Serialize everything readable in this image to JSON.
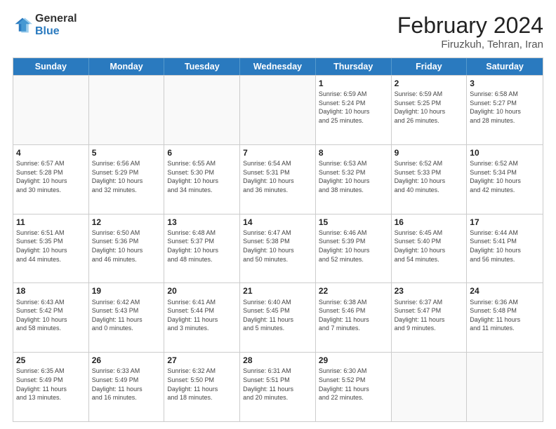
{
  "logo": {
    "general": "General",
    "blue": "Blue"
  },
  "title": "February 2024",
  "subtitle": "Firuzkuh, Tehran, Iran",
  "days": [
    "Sunday",
    "Monday",
    "Tuesday",
    "Wednesday",
    "Thursday",
    "Friday",
    "Saturday"
  ],
  "weeks": [
    [
      {
        "day": "",
        "info": ""
      },
      {
        "day": "",
        "info": ""
      },
      {
        "day": "",
        "info": ""
      },
      {
        "day": "",
        "info": ""
      },
      {
        "day": "1",
        "info": "Sunrise: 6:59 AM\nSunset: 5:24 PM\nDaylight: 10 hours\nand 25 minutes."
      },
      {
        "day": "2",
        "info": "Sunrise: 6:59 AM\nSunset: 5:25 PM\nDaylight: 10 hours\nand 26 minutes."
      },
      {
        "day": "3",
        "info": "Sunrise: 6:58 AM\nSunset: 5:27 PM\nDaylight: 10 hours\nand 28 minutes."
      }
    ],
    [
      {
        "day": "4",
        "info": "Sunrise: 6:57 AM\nSunset: 5:28 PM\nDaylight: 10 hours\nand 30 minutes."
      },
      {
        "day": "5",
        "info": "Sunrise: 6:56 AM\nSunset: 5:29 PM\nDaylight: 10 hours\nand 32 minutes."
      },
      {
        "day": "6",
        "info": "Sunrise: 6:55 AM\nSunset: 5:30 PM\nDaylight: 10 hours\nand 34 minutes."
      },
      {
        "day": "7",
        "info": "Sunrise: 6:54 AM\nSunset: 5:31 PM\nDaylight: 10 hours\nand 36 minutes."
      },
      {
        "day": "8",
        "info": "Sunrise: 6:53 AM\nSunset: 5:32 PM\nDaylight: 10 hours\nand 38 minutes."
      },
      {
        "day": "9",
        "info": "Sunrise: 6:52 AM\nSunset: 5:33 PM\nDaylight: 10 hours\nand 40 minutes."
      },
      {
        "day": "10",
        "info": "Sunrise: 6:52 AM\nSunset: 5:34 PM\nDaylight: 10 hours\nand 42 minutes."
      }
    ],
    [
      {
        "day": "11",
        "info": "Sunrise: 6:51 AM\nSunset: 5:35 PM\nDaylight: 10 hours\nand 44 minutes."
      },
      {
        "day": "12",
        "info": "Sunrise: 6:50 AM\nSunset: 5:36 PM\nDaylight: 10 hours\nand 46 minutes."
      },
      {
        "day": "13",
        "info": "Sunrise: 6:48 AM\nSunset: 5:37 PM\nDaylight: 10 hours\nand 48 minutes."
      },
      {
        "day": "14",
        "info": "Sunrise: 6:47 AM\nSunset: 5:38 PM\nDaylight: 10 hours\nand 50 minutes."
      },
      {
        "day": "15",
        "info": "Sunrise: 6:46 AM\nSunset: 5:39 PM\nDaylight: 10 hours\nand 52 minutes."
      },
      {
        "day": "16",
        "info": "Sunrise: 6:45 AM\nSunset: 5:40 PM\nDaylight: 10 hours\nand 54 minutes."
      },
      {
        "day": "17",
        "info": "Sunrise: 6:44 AM\nSunset: 5:41 PM\nDaylight: 10 hours\nand 56 minutes."
      }
    ],
    [
      {
        "day": "18",
        "info": "Sunrise: 6:43 AM\nSunset: 5:42 PM\nDaylight: 10 hours\nand 58 minutes."
      },
      {
        "day": "19",
        "info": "Sunrise: 6:42 AM\nSunset: 5:43 PM\nDaylight: 11 hours\nand 0 minutes."
      },
      {
        "day": "20",
        "info": "Sunrise: 6:41 AM\nSunset: 5:44 PM\nDaylight: 11 hours\nand 3 minutes."
      },
      {
        "day": "21",
        "info": "Sunrise: 6:40 AM\nSunset: 5:45 PM\nDaylight: 11 hours\nand 5 minutes."
      },
      {
        "day": "22",
        "info": "Sunrise: 6:38 AM\nSunset: 5:46 PM\nDaylight: 11 hours\nand 7 minutes."
      },
      {
        "day": "23",
        "info": "Sunrise: 6:37 AM\nSunset: 5:47 PM\nDaylight: 11 hours\nand 9 minutes."
      },
      {
        "day": "24",
        "info": "Sunrise: 6:36 AM\nSunset: 5:48 PM\nDaylight: 11 hours\nand 11 minutes."
      }
    ],
    [
      {
        "day": "25",
        "info": "Sunrise: 6:35 AM\nSunset: 5:49 PM\nDaylight: 11 hours\nand 13 minutes."
      },
      {
        "day": "26",
        "info": "Sunrise: 6:33 AM\nSunset: 5:49 PM\nDaylight: 11 hours\nand 16 minutes."
      },
      {
        "day": "27",
        "info": "Sunrise: 6:32 AM\nSunset: 5:50 PM\nDaylight: 11 hours\nand 18 minutes."
      },
      {
        "day": "28",
        "info": "Sunrise: 6:31 AM\nSunset: 5:51 PM\nDaylight: 11 hours\nand 20 minutes."
      },
      {
        "day": "29",
        "info": "Sunrise: 6:30 AM\nSunset: 5:52 PM\nDaylight: 11 hours\nand 22 minutes."
      },
      {
        "day": "",
        "info": ""
      },
      {
        "day": "",
        "info": ""
      }
    ]
  ]
}
